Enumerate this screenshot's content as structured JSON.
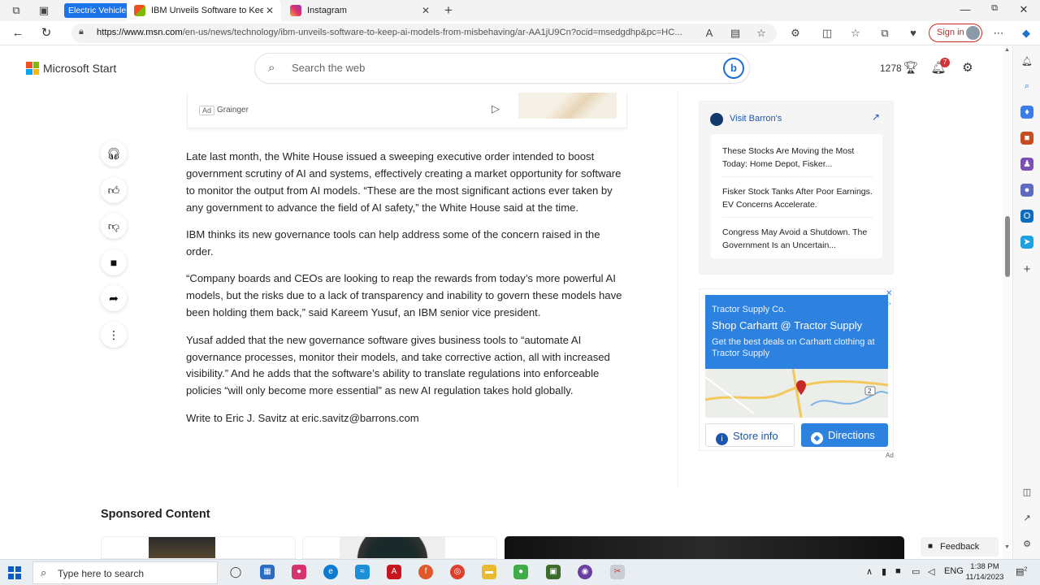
{
  "browser": {
    "tab_group_label": "Electric Vehicle",
    "tabs": [
      {
        "title": "IBM Unveils Software to Keep AI",
        "active": true
      },
      {
        "title": "Instagram",
        "active": false
      }
    ],
    "url_host": "https://www.msn.com",
    "url_path": "/en-us/news/technology/ibm-unveils-software-to-keep-ai-models-from-misbehaving/ar-AA1jU9Cn?ocid=msedgdhp&pc=HC...",
    "signin_label": "Sign in"
  },
  "header": {
    "brand": "Microsoft Start",
    "search_placeholder": "Search the web",
    "points": "1278",
    "notification_count": "7"
  },
  "ad_strip": {
    "ad_tag": "Ad",
    "source": "Grainger"
  },
  "article": {
    "paragraphs": [
      "Late last month, the White House issued a sweeping executive order intended to boost government scrutiny of AI and systems, effectively creating a market opportunity for software to monitor the output from AI models. “These are the most significant actions ever taken by any government to advance the field of AI safety,” the White House said at the time.",
      "IBM thinks its new governance tools can help address some of the concern raised in the order.",
      "“Company boards and CEOs are looking to reap the rewards from today’s more powerful AI models, but the risks due to a lack of transparency and inability to govern these models have been holding them back,” said Kareem Yusuf, an IBM senior vice president.",
      "Yusaf added that the new governance software gives business tools to “automate AI governance processes, monitor their models, and take corrective action, all with increased visibility.” And he adds that the software’s ability to translate regulations into enforceable policies “will only become more essential” as new AI regulation takes hold globally.",
      "Write to Eric J. Savitz at eric.savitz@barrons.com"
    ]
  },
  "barrons": {
    "visit_label": "Visit Barron's",
    "items": [
      "These Stocks Are Moving the Most Today: Home Depot, Fisker...",
      "Fisker Stock Tanks After Poor Earnings. EV Concerns Accelerate.",
      "Congress May Avoid a Shutdown. The Government Is an Uncertain..."
    ]
  },
  "tractor_ad": {
    "company": "Tractor Supply Co.",
    "headline": "Shop Carhartt @ Tractor Supply",
    "subtext": "Get the best deals on Carhartt clothing at Tractor Supply",
    "map_road_label": "2",
    "store_info_label": "Store info",
    "directions_label": "Directions",
    "ad_label": "Ad"
  },
  "sponsored": {
    "heading": "Sponsored Content",
    "feedback_label": "Feedback"
  },
  "taskbar": {
    "search_placeholder": "Type here to search",
    "language": "ENG",
    "time": "1:38 PM",
    "date": "11/14/2023",
    "notification_count": "2"
  }
}
